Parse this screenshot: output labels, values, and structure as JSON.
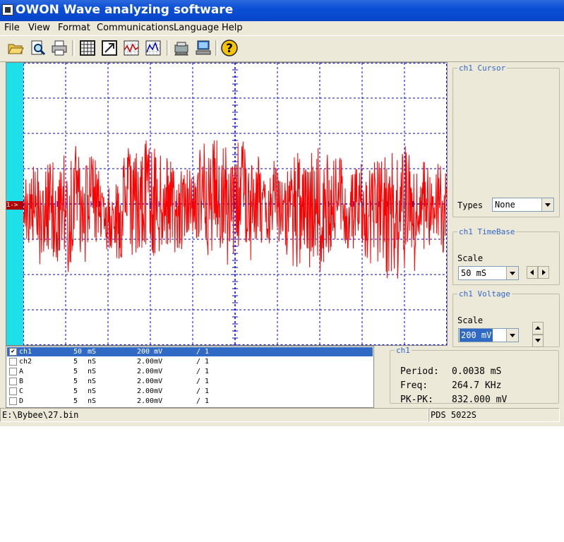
{
  "window": {
    "title": "OWON Wave analyzing software"
  },
  "menu": [
    "File",
    "View",
    "Format",
    "Communications",
    "Language",
    "Help"
  ],
  "toolbar": {
    "icons": [
      "open-folder-icon",
      "zoom-icon",
      "print-icon",
      "table-icon",
      "export-icon",
      "waveform-icon",
      "spectrum-icon",
      "device-icon",
      "connect-icon",
      "help-icon"
    ],
    "help_glyph": "?"
  },
  "scope": {
    "channel_marker": "1->",
    "trace_color": "#ff0000",
    "grid_color": "#0000cc",
    "side_color": "#1ee0e8"
  },
  "cursor_panel": {
    "title": "ch1 Cursor",
    "types_label": "Types",
    "types_value": "None"
  },
  "timebase_panel": {
    "title": "ch1 TimeBase",
    "scale_label": "Scale",
    "scale_value": "50 mS"
  },
  "voltage_panel": {
    "title": "ch1 Voltage",
    "scale_label": "Scale",
    "scale_value": "200 mV"
  },
  "channels": [
    {
      "name": "ch1",
      "time": "50",
      "time_unit": "mS",
      "volt": "200 mV",
      "probe": "/ 1",
      "checked": true,
      "selected": true
    },
    {
      "name": "ch2",
      "time": "5",
      "time_unit": "nS",
      "volt": "2.00mV",
      "probe": "/ 1",
      "checked": false,
      "selected": false
    },
    {
      "name": "A",
      "time": "5",
      "time_unit": "nS",
      "volt": "2.00mV",
      "probe": "/ 1",
      "checked": false,
      "selected": false
    },
    {
      "name": "B",
      "time": "5",
      "time_unit": "nS",
      "volt": "2.00mV",
      "probe": "/ 1",
      "checked": false,
      "selected": false
    },
    {
      "name": "C",
      "time": "5",
      "time_unit": "nS",
      "volt": "2.00mV",
      "probe": "/ 1",
      "checked": false,
      "selected": false
    },
    {
      "name": "D",
      "time": "5",
      "time_unit": "nS",
      "volt": "2.00mV",
      "probe": "/ 1",
      "checked": false,
      "selected": false
    }
  ],
  "measure": {
    "title": "ch1",
    "period_label": "Period:",
    "period_value": "0.0038 mS",
    "freq_label": "Freq:",
    "freq_value": "264.7 KHz",
    "pkpk_label": "PK-PK:",
    "pkpk_value": "832.000 mV"
  },
  "status": {
    "path": "E:\\Bybee\\27.bin",
    "device": "PDS 5022S"
  }
}
